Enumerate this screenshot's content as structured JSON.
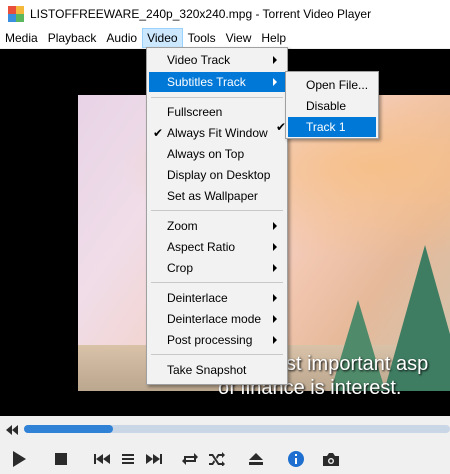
{
  "window": {
    "title": "LISTOFFREEWARE_240p_320x240.mpg - Torrent Video Player"
  },
  "menubar": {
    "items": [
      "Media",
      "Playback",
      "Audio",
      "Video",
      "Tools",
      "View",
      "Help"
    ],
    "active": "Video"
  },
  "video_menu": {
    "items": [
      {
        "label": "Video Track",
        "submenu": true
      },
      {
        "label": "Subtitles Track",
        "submenu": true,
        "highlighted": true
      },
      {
        "label": "Fullscreen"
      },
      {
        "label": "Always Fit Window",
        "checked": true
      },
      {
        "label": "Always on Top"
      },
      {
        "label": "Display on Desktop"
      },
      {
        "label": "Set as Wallpaper"
      },
      {
        "label": "Zoom",
        "submenu": true
      },
      {
        "label": "Aspect Ratio",
        "submenu": true
      },
      {
        "label": "Crop",
        "submenu": true
      },
      {
        "label": "Deinterlace",
        "submenu": true
      },
      {
        "label": "Deinterlace mode",
        "submenu": true
      },
      {
        "label": "Post processing",
        "submenu": true
      },
      {
        "label": "Take Snapshot"
      }
    ]
  },
  "subtitles_menu": {
    "items": [
      {
        "label": "Open File..."
      },
      {
        "label": "Disable"
      },
      {
        "label": "Track 1",
        "checked": true,
        "highlighted": true
      }
    ]
  },
  "subtitle": {
    "line1": "st important asp",
    "line2": "of finance is interest."
  },
  "playback": {
    "progress_fraction": 0.21
  },
  "controls": {
    "icons": [
      "play-icon",
      "stop-icon",
      "previous-icon",
      "playlist-icon",
      "next-icon",
      "repeat-icon",
      "shuffle-icon",
      "eject-icon",
      "info-icon",
      "snapshot-icon"
    ]
  },
  "colors": {
    "highlight": "#0078d7",
    "menubar_active": "#cce8ff",
    "seek_fill": "#2f82d6",
    "info_icon": "#1e6fd0"
  }
}
